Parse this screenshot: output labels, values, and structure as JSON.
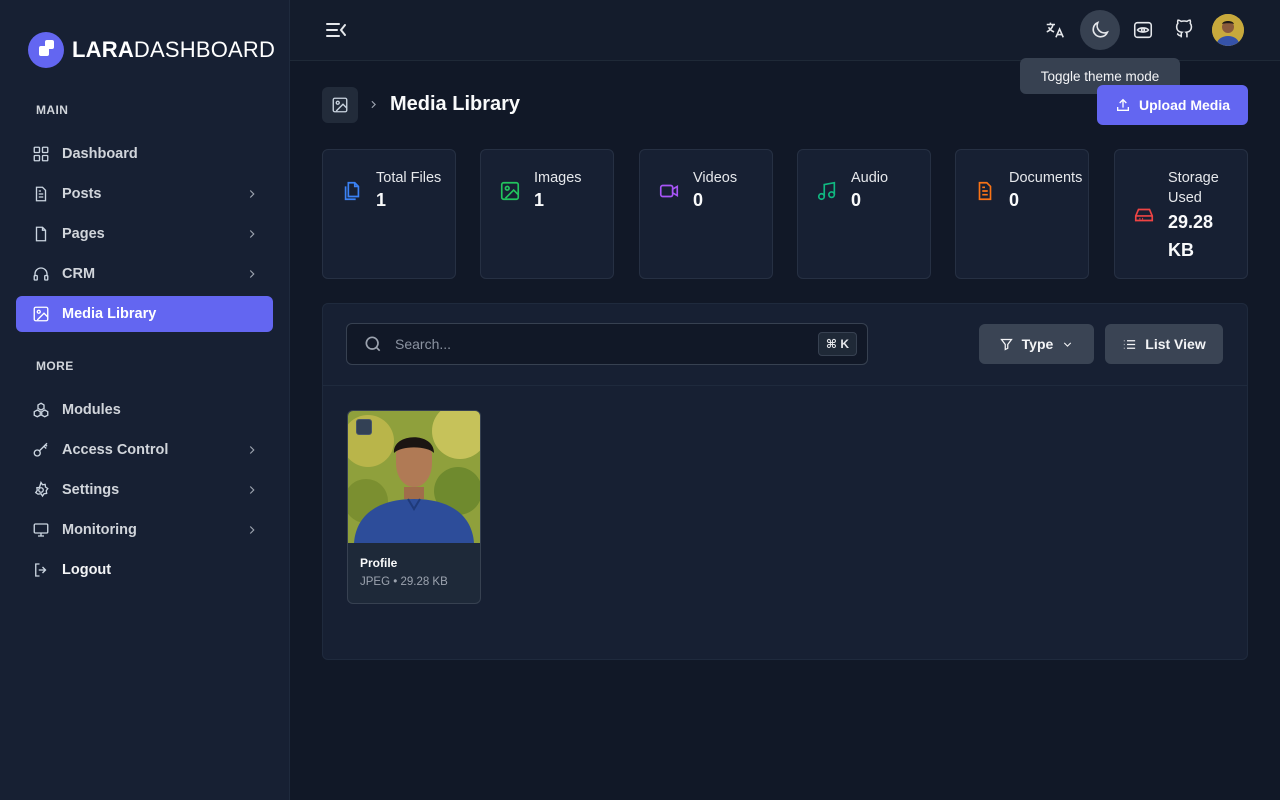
{
  "brand": {
    "bold": "LARA",
    "light": "DASHBOARD"
  },
  "sidebar": {
    "main_label": "MAIN",
    "more_label": "MORE",
    "main_items": [
      {
        "label": "Dashboard",
        "icon": "grid-icon",
        "has_children": false
      },
      {
        "label": "Posts",
        "icon": "document-icon",
        "has_children": true
      },
      {
        "label": "Pages",
        "icon": "file-icon",
        "has_children": true
      },
      {
        "label": "CRM",
        "icon": "headphones-icon",
        "has_children": true
      },
      {
        "label": "Media Library",
        "icon": "image-icon",
        "has_children": false,
        "active": true
      }
    ],
    "more_items": [
      {
        "label": "Modules",
        "icon": "modules-icon",
        "has_children": false
      },
      {
        "label": "Access Control",
        "icon": "key-icon",
        "has_children": true
      },
      {
        "label": "Settings",
        "icon": "gear-icon",
        "has_children": true
      },
      {
        "label": "Monitoring",
        "icon": "monitor-icon",
        "has_children": true
      },
      {
        "label": "Logout",
        "icon": "logout-icon",
        "has_children": false
      }
    ]
  },
  "topbar": {
    "tooltip": "Toggle theme mode"
  },
  "header": {
    "title": "Media Library",
    "upload_label": "Upload Media"
  },
  "stats": [
    {
      "label": "Total Files",
      "value": "1",
      "icon": "files-icon",
      "color": "#3b82f6"
    },
    {
      "label": "Images",
      "value": "1",
      "icon": "image-icon",
      "color": "#22c55e"
    },
    {
      "label": "Videos",
      "value": "0",
      "icon": "video-icon",
      "color": "#a855f7"
    },
    {
      "label": "Audio",
      "value": "0",
      "icon": "music-icon",
      "color": "#10b981"
    },
    {
      "label": "Documents",
      "value": "0",
      "icon": "document-icon",
      "color": "#f97316"
    },
    {
      "label": "Storage Used",
      "value": "29.28 KB",
      "icon": "drive-icon",
      "color": "#ef4444"
    }
  ],
  "toolbar": {
    "search_placeholder": "Search...",
    "shortcut": "⌘ K",
    "type_label": "Type",
    "view_label": "List View"
  },
  "media": [
    {
      "name": "Profile",
      "meta": "JPEG • 29.28 KB"
    }
  ],
  "colors": {
    "accent": "#6366f1",
    "background": "#111827",
    "sidebar": "#172033"
  }
}
